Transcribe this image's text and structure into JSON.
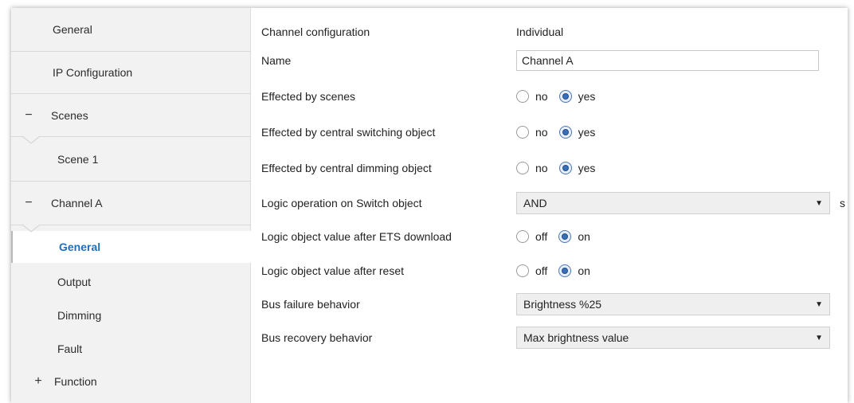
{
  "sidebar": {
    "items": [
      {
        "label": "General"
      },
      {
        "label": "IP Configuration"
      },
      {
        "label": "Scenes",
        "sign": "−"
      },
      {
        "label": "Scene 1"
      },
      {
        "label": "Channel A",
        "sign": "−"
      },
      {
        "label": "General"
      },
      {
        "label": "Output"
      },
      {
        "label": "Dimming"
      },
      {
        "label": "Fault"
      },
      {
        "label": "Function",
        "sign": "+"
      }
    ]
  },
  "params": {
    "channel_config": {
      "label": "Channel configuration",
      "value": "Individual"
    },
    "name": {
      "label": "Name",
      "value": "Channel A"
    },
    "scenes": {
      "label": "Effected by scenes",
      "opt_no": "no",
      "opt_yes": "yes"
    },
    "central_switch": {
      "label": "Effected by central switching object",
      "opt_no": "no",
      "opt_yes": "yes"
    },
    "central_dim": {
      "label": "Effected by central dimming object",
      "opt_no": "no",
      "opt_yes": "yes"
    },
    "logic_op": {
      "label": "Logic operation on Switch object",
      "value": "AND",
      "unit": "s"
    },
    "logic_after_ets": {
      "label": "Logic object value after ETS download",
      "opt_off": "off",
      "opt_on": "on"
    },
    "logic_after_reset": {
      "label": "Logic object value after reset",
      "opt_off": "off",
      "opt_on": "on"
    },
    "bus_failure": {
      "label": "Bus failure behavior",
      "value": "Brightness %25"
    },
    "bus_recovery": {
      "label": "Bus recovery behavior",
      "value": "Max brightness value"
    }
  },
  "icons": {
    "expand": "plus-icon",
    "collapse": "minus-icon",
    "dropdown": "chevron-down-icon"
  },
  "colors": {
    "selected_text": "#1e6fb8",
    "radio_checked": "#3a6fb5",
    "sidebar_bg": "#f2f2f2"
  }
}
